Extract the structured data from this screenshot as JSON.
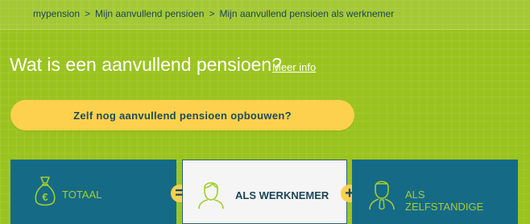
{
  "breadcrumb": {
    "items": [
      "mypension",
      "Mijn aanvullend pensioen",
      "Mijn aanvullend pensioen als werknemer"
    ],
    "separator": ">"
  },
  "header": {
    "title": "Wat is een aanvullend pensioen?",
    "more_link": "Meer info"
  },
  "cta": {
    "label": "Zelf nog aanvullend pensioen opbouwen?"
  },
  "tiles": [
    {
      "label": "TOTAAL",
      "icon": "money-bag-euro-icon"
    },
    {
      "label": "ALS WERKNEMER",
      "icon": "person-outline-icon"
    },
    {
      "label_lines": [
        "ALS",
        "ZELFSTANDIGE"
      ],
      "icon": "person-tie-icon"
    }
  ],
  "operators": {
    "equals": "=",
    "plus": "+"
  },
  "colors": {
    "background": "#9bc31f",
    "tile_dark": "#156b86",
    "tile_light": "#f5f5f5",
    "accent_yellow": "#fdd14d",
    "label_green": "#a4cc30",
    "text_dark": "#1c4557"
  }
}
